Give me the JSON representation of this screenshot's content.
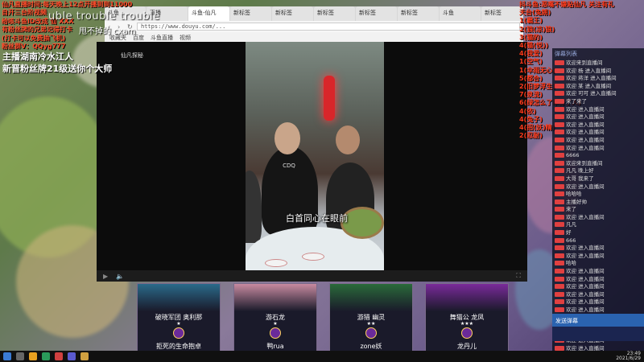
{
  "overlay": {
    "red_lines": [
      "仙凡直播时间:每天晚上12点开播到到11000",
      "自开三台阶视频",
      "给咳斗鱼ID改成 仙 XXX",
      "有粉丝牌的兄弟记得打卡",
      "(打卡可以免费抽飞机)",
      "粉丝群V：QQyg777"
    ],
    "ghost_text": "uble  trouble  trouble",
    "ghost_text2": "甩不掉的 cxam",
    "host_line1": "主播湖南冷水江人",
    "host_line2": "新晋粉丝牌21级送你个大师"
  },
  "right_list": [
    "抖斗鱼:恶嘴不嫌贴仙凡 关注有礼",
    "天台(兔朗)",
    "1(霸王)",
    "2(狼(凉)狼)",
    "3(猫的)",
    "4(猫(悦))",
    "4(我爱)",
    "1(空气)",
    "1(伞雨无心)",
    "5(都合)",
    "2(旧梦浮生)",
    "7(泉流)",
    "6(绿怎么了单身了人)",
    "4(依)",
    "4(兔子)",
    "4(招(妖)精)",
    "2(忍耐)"
  ],
  "browser": {
    "tabs": [
      "斗鱼",
      "直播",
      "斗鱼-仙凡",
      "新标签",
      "新标签",
      "新标签",
      "新标签",
      "新标签",
      "斗鱼",
      "新标签"
    ],
    "url": "https://www.douyu.com/...",
    "bookmarks": [
      "收藏夹",
      "百度",
      "斗鱼直播",
      "视频"
    ]
  },
  "player": {
    "logo": "仙凡探秘",
    "subtitle": "白首同心在眼前",
    "shirt_text": "CDQ"
  },
  "chat": {
    "header": "弹幕列表",
    "lines": [
      "欢迎来到直播间",
      "欢迎 杨 进入直播间",
      "欢迎 蒋洋 进入直播间",
      "欢迎 某 进入直播间",
      "欢迎 可可 进入直播间",
      "来了来了",
      "欢迎 进入直播间",
      "欢迎 进入直播间",
      "欢迎 进入直播间",
      "欢迎 进入直播间",
      "欢迎 进入直播间",
      "欢迎 进入直播间",
      "6666",
      "欢迎来到直播间",
      "凡凡 晚上好",
      "大哥 我来了",
      "欢迎 进入直播间",
      "哈哈哈",
      "主播好帅",
      "来了",
      "欢迎 进入直播间",
      "凡凡",
      "好",
      "666",
      "欢迎 进入直播间",
      "欢迎 进入直播间",
      "哈哈",
      "欢迎 进入直播间",
      "欢迎 进入直播间",
      "欢迎 进入直播间",
      "欢迎 进入直播间",
      "欢迎 进入直播间",
      "欢迎 进入直播间",
      "欢迎 进入直播间",
      "欢迎 进入直播间",
      "欢迎 进入直播间",
      "欢迎 进入直播间",
      "欢迎 进入直播间"
    ],
    "input_placeholder": "发送弹幕"
  },
  "cards": [
    {
      "title": "破晓军团 奥利那",
      "stars": "★",
      "name": "拒死的生命抱卓",
      "color": "#2a6a8a"
    },
    {
      "title": "游石龙",
      "stars": "★",
      "name": "鸭rua",
      "color": "#c88aa0"
    },
    {
      "title": "游猎 幽灵",
      "stars": "★★",
      "name": "zone妖",
      "color": "#2a6a3a"
    },
    {
      "title": "舞猫公 龙凤",
      "stars": "★★★",
      "name": "龙丹儿",
      "color": "#7a2a9a"
    }
  ],
  "taskbar": {
    "time": "23:49",
    "date": "2021/6/29"
  }
}
